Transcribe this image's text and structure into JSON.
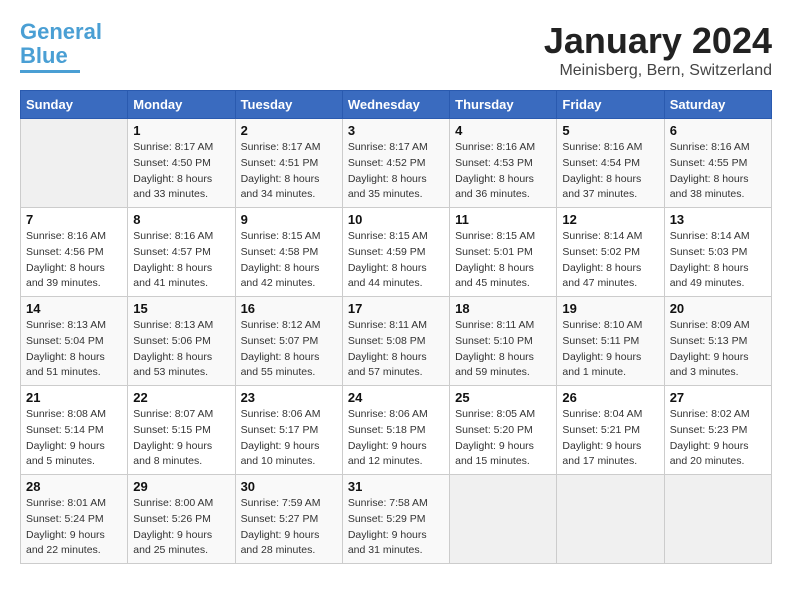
{
  "logo": {
    "line1": "General",
    "line2": "Blue"
  },
  "title": "January 2024",
  "subtitle": "Meinisberg, Bern, Switzerland",
  "headers": [
    "Sunday",
    "Monday",
    "Tuesday",
    "Wednesday",
    "Thursday",
    "Friday",
    "Saturday"
  ],
  "weeks": [
    [
      {
        "day": "",
        "info": ""
      },
      {
        "day": "1",
        "info": "Sunrise: 8:17 AM\nSunset: 4:50 PM\nDaylight: 8 hours\nand 33 minutes."
      },
      {
        "day": "2",
        "info": "Sunrise: 8:17 AM\nSunset: 4:51 PM\nDaylight: 8 hours\nand 34 minutes."
      },
      {
        "day": "3",
        "info": "Sunrise: 8:17 AM\nSunset: 4:52 PM\nDaylight: 8 hours\nand 35 minutes."
      },
      {
        "day": "4",
        "info": "Sunrise: 8:16 AM\nSunset: 4:53 PM\nDaylight: 8 hours\nand 36 minutes."
      },
      {
        "day": "5",
        "info": "Sunrise: 8:16 AM\nSunset: 4:54 PM\nDaylight: 8 hours\nand 37 minutes."
      },
      {
        "day": "6",
        "info": "Sunrise: 8:16 AM\nSunset: 4:55 PM\nDaylight: 8 hours\nand 38 minutes."
      }
    ],
    [
      {
        "day": "7",
        "info": "Sunrise: 8:16 AM\nSunset: 4:56 PM\nDaylight: 8 hours\nand 39 minutes."
      },
      {
        "day": "8",
        "info": "Sunrise: 8:16 AM\nSunset: 4:57 PM\nDaylight: 8 hours\nand 41 minutes."
      },
      {
        "day": "9",
        "info": "Sunrise: 8:15 AM\nSunset: 4:58 PM\nDaylight: 8 hours\nand 42 minutes."
      },
      {
        "day": "10",
        "info": "Sunrise: 8:15 AM\nSunset: 4:59 PM\nDaylight: 8 hours\nand 44 minutes."
      },
      {
        "day": "11",
        "info": "Sunrise: 8:15 AM\nSunset: 5:01 PM\nDaylight: 8 hours\nand 45 minutes."
      },
      {
        "day": "12",
        "info": "Sunrise: 8:14 AM\nSunset: 5:02 PM\nDaylight: 8 hours\nand 47 minutes."
      },
      {
        "day": "13",
        "info": "Sunrise: 8:14 AM\nSunset: 5:03 PM\nDaylight: 8 hours\nand 49 minutes."
      }
    ],
    [
      {
        "day": "14",
        "info": "Sunrise: 8:13 AM\nSunset: 5:04 PM\nDaylight: 8 hours\nand 51 minutes."
      },
      {
        "day": "15",
        "info": "Sunrise: 8:13 AM\nSunset: 5:06 PM\nDaylight: 8 hours\nand 53 minutes."
      },
      {
        "day": "16",
        "info": "Sunrise: 8:12 AM\nSunset: 5:07 PM\nDaylight: 8 hours\nand 55 minutes."
      },
      {
        "day": "17",
        "info": "Sunrise: 8:11 AM\nSunset: 5:08 PM\nDaylight: 8 hours\nand 57 minutes."
      },
      {
        "day": "18",
        "info": "Sunrise: 8:11 AM\nSunset: 5:10 PM\nDaylight: 8 hours\nand 59 minutes."
      },
      {
        "day": "19",
        "info": "Sunrise: 8:10 AM\nSunset: 5:11 PM\nDaylight: 9 hours\nand 1 minute."
      },
      {
        "day": "20",
        "info": "Sunrise: 8:09 AM\nSunset: 5:13 PM\nDaylight: 9 hours\nand 3 minutes."
      }
    ],
    [
      {
        "day": "21",
        "info": "Sunrise: 8:08 AM\nSunset: 5:14 PM\nDaylight: 9 hours\nand 5 minutes."
      },
      {
        "day": "22",
        "info": "Sunrise: 8:07 AM\nSunset: 5:15 PM\nDaylight: 9 hours\nand 8 minutes."
      },
      {
        "day": "23",
        "info": "Sunrise: 8:06 AM\nSunset: 5:17 PM\nDaylight: 9 hours\nand 10 minutes."
      },
      {
        "day": "24",
        "info": "Sunrise: 8:06 AM\nSunset: 5:18 PM\nDaylight: 9 hours\nand 12 minutes."
      },
      {
        "day": "25",
        "info": "Sunrise: 8:05 AM\nSunset: 5:20 PM\nDaylight: 9 hours\nand 15 minutes."
      },
      {
        "day": "26",
        "info": "Sunrise: 8:04 AM\nSunset: 5:21 PM\nDaylight: 9 hours\nand 17 minutes."
      },
      {
        "day": "27",
        "info": "Sunrise: 8:02 AM\nSunset: 5:23 PM\nDaylight: 9 hours\nand 20 minutes."
      }
    ],
    [
      {
        "day": "28",
        "info": "Sunrise: 8:01 AM\nSunset: 5:24 PM\nDaylight: 9 hours\nand 22 minutes."
      },
      {
        "day": "29",
        "info": "Sunrise: 8:00 AM\nSunset: 5:26 PM\nDaylight: 9 hours\nand 25 minutes."
      },
      {
        "day": "30",
        "info": "Sunrise: 7:59 AM\nSunset: 5:27 PM\nDaylight: 9 hours\nand 28 minutes."
      },
      {
        "day": "31",
        "info": "Sunrise: 7:58 AM\nSunset: 5:29 PM\nDaylight: 9 hours\nand 31 minutes."
      },
      {
        "day": "",
        "info": ""
      },
      {
        "day": "",
        "info": ""
      },
      {
        "day": "",
        "info": ""
      }
    ]
  ]
}
